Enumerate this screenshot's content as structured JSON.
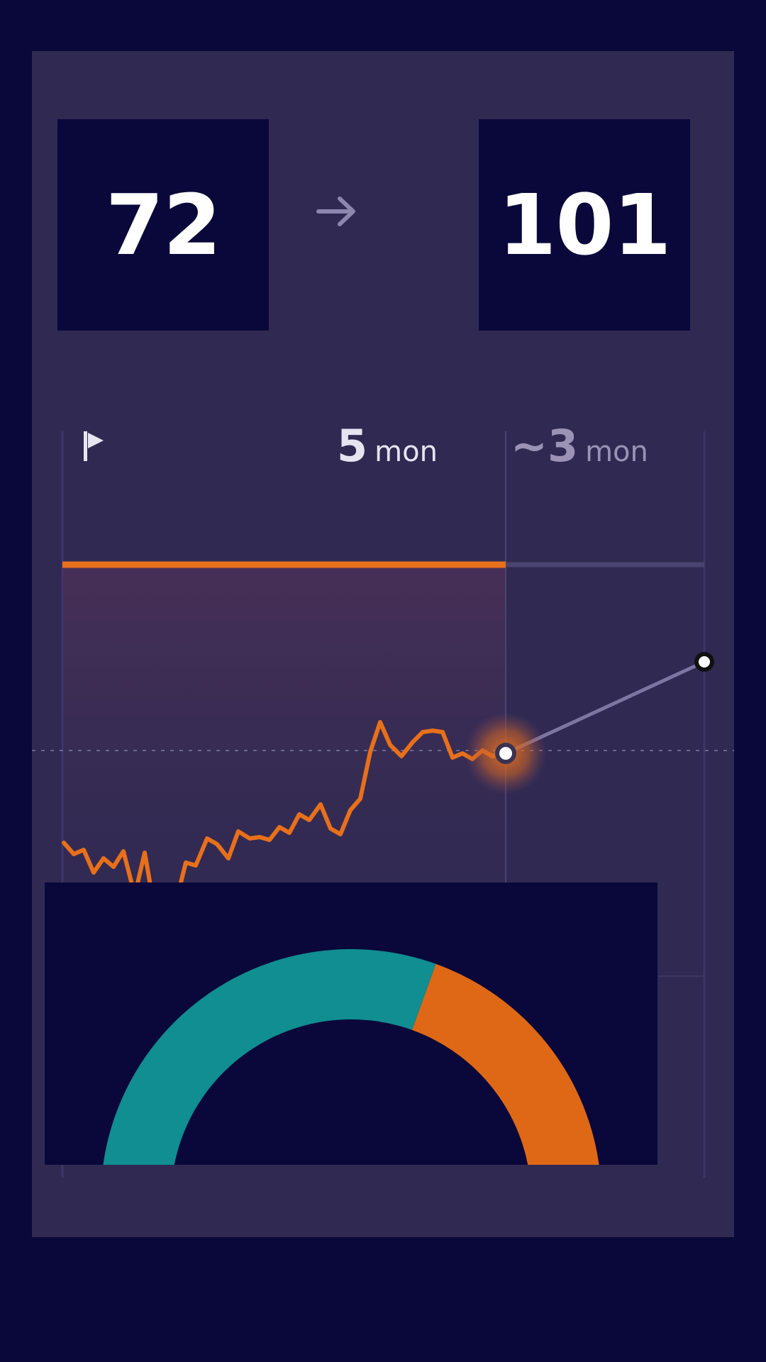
{
  "scores": {
    "start": "72",
    "target": "101"
  },
  "icons": {
    "arrow": "arrow-right-icon",
    "flag": "flag-icon"
  },
  "timeline": {
    "elapsed": {
      "value": "5",
      "unit": "mon"
    },
    "remaining": {
      "value": "~3",
      "unit": "mon"
    }
  },
  "colors": {
    "background": "#0a083a",
    "card": "#302a52",
    "accent": "#e8701b",
    "teal": "#108e91",
    "gauge_orange": "#df6816"
  },
  "gauge": {
    "segments": [
      {
        "name": "teal",
        "fraction": 0.61
      },
      {
        "name": "orange",
        "fraction": 0.39
      }
    ]
  },
  "progress": {
    "elapsed_fraction": 0.69
  }
}
